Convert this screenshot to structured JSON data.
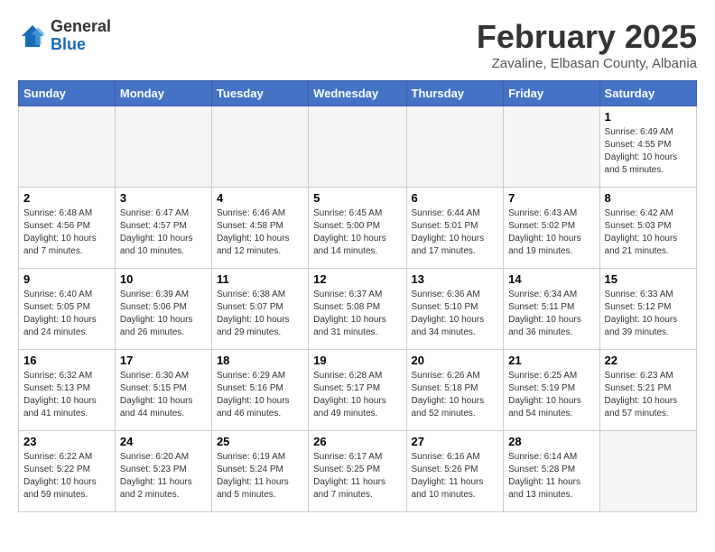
{
  "header": {
    "logo_general": "General",
    "logo_blue": "Blue",
    "title": "February 2025",
    "subtitle": "Zavaline, Elbasan County, Albania"
  },
  "days_of_week": [
    "Sunday",
    "Monday",
    "Tuesday",
    "Wednesday",
    "Thursday",
    "Friday",
    "Saturday"
  ],
  "weeks": [
    [
      {
        "day": "",
        "info": ""
      },
      {
        "day": "",
        "info": ""
      },
      {
        "day": "",
        "info": ""
      },
      {
        "day": "",
        "info": ""
      },
      {
        "day": "",
        "info": ""
      },
      {
        "day": "",
        "info": ""
      },
      {
        "day": "1",
        "info": "Sunrise: 6:49 AM\nSunset: 4:55 PM\nDaylight: 10 hours and 5 minutes."
      }
    ],
    [
      {
        "day": "2",
        "info": "Sunrise: 6:48 AM\nSunset: 4:56 PM\nDaylight: 10 hours and 7 minutes."
      },
      {
        "day": "3",
        "info": "Sunrise: 6:47 AM\nSunset: 4:57 PM\nDaylight: 10 hours and 10 minutes."
      },
      {
        "day": "4",
        "info": "Sunrise: 6:46 AM\nSunset: 4:58 PM\nDaylight: 10 hours and 12 minutes."
      },
      {
        "day": "5",
        "info": "Sunrise: 6:45 AM\nSunset: 5:00 PM\nDaylight: 10 hours and 14 minutes."
      },
      {
        "day": "6",
        "info": "Sunrise: 6:44 AM\nSunset: 5:01 PM\nDaylight: 10 hours and 17 minutes."
      },
      {
        "day": "7",
        "info": "Sunrise: 6:43 AM\nSunset: 5:02 PM\nDaylight: 10 hours and 19 minutes."
      },
      {
        "day": "8",
        "info": "Sunrise: 6:42 AM\nSunset: 5:03 PM\nDaylight: 10 hours and 21 minutes."
      }
    ],
    [
      {
        "day": "9",
        "info": "Sunrise: 6:40 AM\nSunset: 5:05 PM\nDaylight: 10 hours and 24 minutes."
      },
      {
        "day": "10",
        "info": "Sunrise: 6:39 AM\nSunset: 5:06 PM\nDaylight: 10 hours and 26 minutes."
      },
      {
        "day": "11",
        "info": "Sunrise: 6:38 AM\nSunset: 5:07 PM\nDaylight: 10 hours and 29 minutes."
      },
      {
        "day": "12",
        "info": "Sunrise: 6:37 AM\nSunset: 5:08 PM\nDaylight: 10 hours and 31 minutes."
      },
      {
        "day": "13",
        "info": "Sunrise: 6:36 AM\nSunset: 5:10 PM\nDaylight: 10 hours and 34 minutes."
      },
      {
        "day": "14",
        "info": "Sunrise: 6:34 AM\nSunset: 5:11 PM\nDaylight: 10 hours and 36 minutes."
      },
      {
        "day": "15",
        "info": "Sunrise: 6:33 AM\nSunset: 5:12 PM\nDaylight: 10 hours and 39 minutes."
      }
    ],
    [
      {
        "day": "16",
        "info": "Sunrise: 6:32 AM\nSunset: 5:13 PM\nDaylight: 10 hours and 41 minutes."
      },
      {
        "day": "17",
        "info": "Sunrise: 6:30 AM\nSunset: 5:15 PM\nDaylight: 10 hours and 44 minutes."
      },
      {
        "day": "18",
        "info": "Sunrise: 6:29 AM\nSunset: 5:16 PM\nDaylight: 10 hours and 46 minutes."
      },
      {
        "day": "19",
        "info": "Sunrise: 6:28 AM\nSunset: 5:17 PM\nDaylight: 10 hours and 49 minutes."
      },
      {
        "day": "20",
        "info": "Sunrise: 6:26 AM\nSunset: 5:18 PM\nDaylight: 10 hours and 52 minutes."
      },
      {
        "day": "21",
        "info": "Sunrise: 6:25 AM\nSunset: 5:19 PM\nDaylight: 10 hours and 54 minutes."
      },
      {
        "day": "22",
        "info": "Sunrise: 6:23 AM\nSunset: 5:21 PM\nDaylight: 10 hours and 57 minutes."
      }
    ],
    [
      {
        "day": "23",
        "info": "Sunrise: 6:22 AM\nSunset: 5:22 PM\nDaylight: 10 hours and 59 minutes."
      },
      {
        "day": "24",
        "info": "Sunrise: 6:20 AM\nSunset: 5:23 PM\nDaylight: 11 hours and 2 minutes."
      },
      {
        "day": "25",
        "info": "Sunrise: 6:19 AM\nSunset: 5:24 PM\nDaylight: 11 hours and 5 minutes."
      },
      {
        "day": "26",
        "info": "Sunrise: 6:17 AM\nSunset: 5:25 PM\nDaylight: 11 hours and 7 minutes."
      },
      {
        "day": "27",
        "info": "Sunrise: 6:16 AM\nSunset: 5:26 PM\nDaylight: 11 hours and 10 minutes."
      },
      {
        "day": "28",
        "info": "Sunrise: 6:14 AM\nSunset: 5:28 PM\nDaylight: 11 hours and 13 minutes."
      },
      {
        "day": "",
        "info": ""
      }
    ]
  ]
}
